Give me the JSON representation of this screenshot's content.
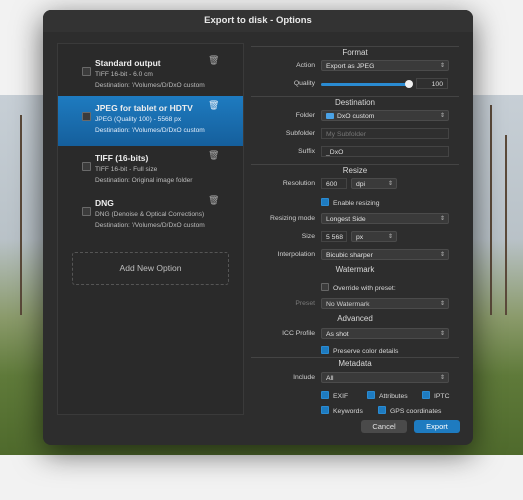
{
  "window": {
    "title": "Export to disk - Options"
  },
  "presets": [
    {
      "name": "Standard output",
      "line1": "TIFF 16-bit - 6.0 cm",
      "line2": "Destination: '/Volumes/D/DxO custom",
      "selected": false
    },
    {
      "name": "JPEG for tablet or HDTV",
      "line1": "JPEG (Quality 100) - 5568 px",
      "line2": "Destination: '/Volumes/D/DxO custom",
      "selected": true
    },
    {
      "name": "TIFF (16-bits)",
      "line1": "TIFF 16-bit - Full size",
      "line2": "Destination: Original image folder",
      "selected": false
    },
    {
      "name": "DNG",
      "line1": "DNG (Denoise & Optical Corrections)",
      "line2": "Destination: '/Volumes/D/DxO custom",
      "selected": false
    }
  ],
  "add_new": "Add New Option",
  "format": {
    "header": "Format",
    "action_label": "Action",
    "action_value": "Export as JPEG",
    "quality_label": "Quality",
    "quality_value": "100",
    "quality_fraction": 1.0
  },
  "destination": {
    "header": "Destination",
    "folder_label": "Folder",
    "folder_value": "DxO custom",
    "subfolder_label": "Subfolder",
    "subfolder_placeholder": "My Subfolder",
    "suffix_label": "Suffix",
    "suffix_value": "_DxO"
  },
  "resize": {
    "header": "Resize",
    "resolution_label": "Resolution",
    "resolution_value": "600",
    "resolution_unit": "dpi",
    "enable_label": "Enable resizing",
    "enable_checked": true,
    "mode_label": "Resizing mode",
    "mode_value": "Longest Side",
    "size_label": "Size",
    "size_value": "5 568",
    "size_unit": "px",
    "interp_label": "Interpolation",
    "interp_value": "Bicubic sharper"
  },
  "watermark": {
    "header": "Watermark",
    "override_label": "Override with preset:",
    "override_checked": false,
    "preset_label": "Preset",
    "preset_value": "No Watermark"
  },
  "advanced": {
    "header": "Advanced",
    "icc_label": "ICC Profile",
    "icc_value": "As shot",
    "preserve_label": "Preserve color details",
    "preserve_checked": true
  },
  "metadata": {
    "header": "Metadata",
    "include_label": "Include",
    "include_value": "All",
    "exif": "EXIF",
    "attributes": "Attributes",
    "iptc": "IPTC",
    "keywords": "Keywords",
    "gps": "GPS coordinates"
  },
  "buttons": {
    "cancel": "Cancel",
    "export": "Export"
  }
}
